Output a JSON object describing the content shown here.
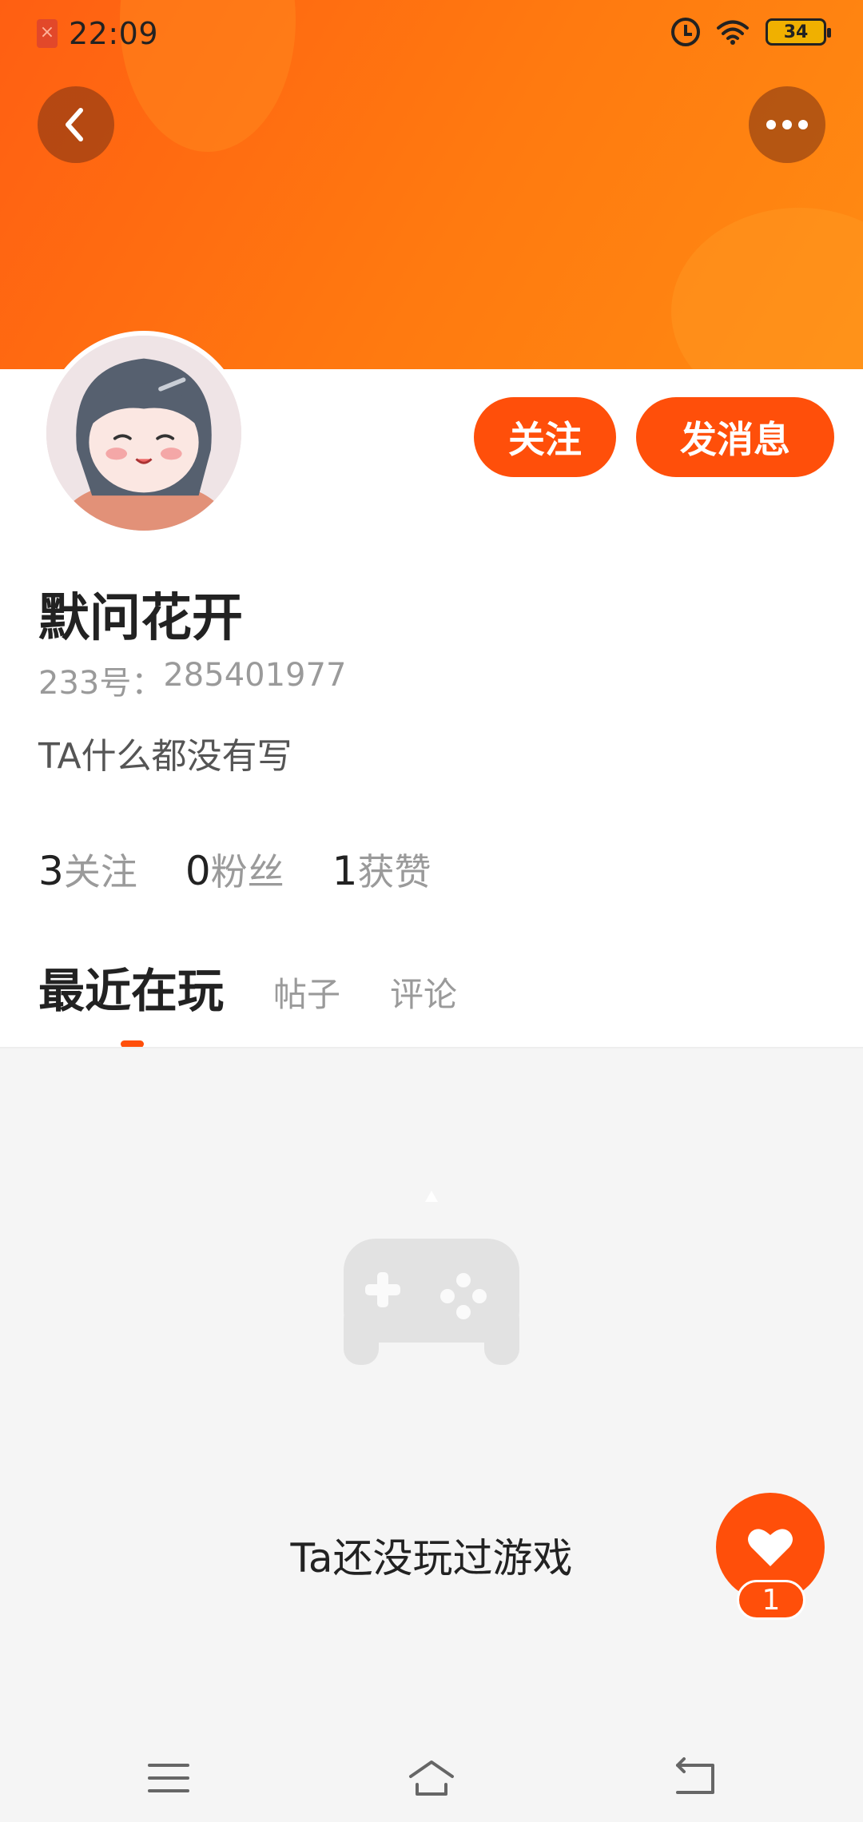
{
  "status_bar": {
    "time": "22:09",
    "battery": "34",
    "icons": [
      "sim-error-icon",
      "alarm-icon",
      "wifi-icon",
      "battery-icon"
    ]
  },
  "header": {
    "back_icon": "chevron-left-icon",
    "more_icon": "more-dots-icon"
  },
  "actions": {
    "follow_label": "关注",
    "message_label": "发消息"
  },
  "profile": {
    "name": "默问花开",
    "id_label": "233号：",
    "id_value": "285401977",
    "bio": "TA什么都没有写"
  },
  "stats": [
    {
      "num": "3",
      "label": "关注"
    },
    {
      "num": "0",
      "label": "粉丝"
    },
    {
      "num": "1",
      "label": "获赞"
    }
  ],
  "tabs": [
    {
      "label": "最近在玩",
      "active": true
    },
    {
      "label": "帖子",
      "active": false
    },
    {
      "label": "评论",
      "active": false
    }
  ],
  "empty_state": {
    "icon": "gamepad-icon",
    "text": "Ta还没玩过游戏"
  },
  "like": {
    "icon": "heart-icon",
    "count": "1"
  },
  "colors": {
    "accent": "#ff4f0a",
    "banner_start": "#ff5f12",
    "banner_end": "#ff8b12"
  },
  "nav": [
    "menu-icon",
    "home-icon",
    "back-icon"
  ]
}
